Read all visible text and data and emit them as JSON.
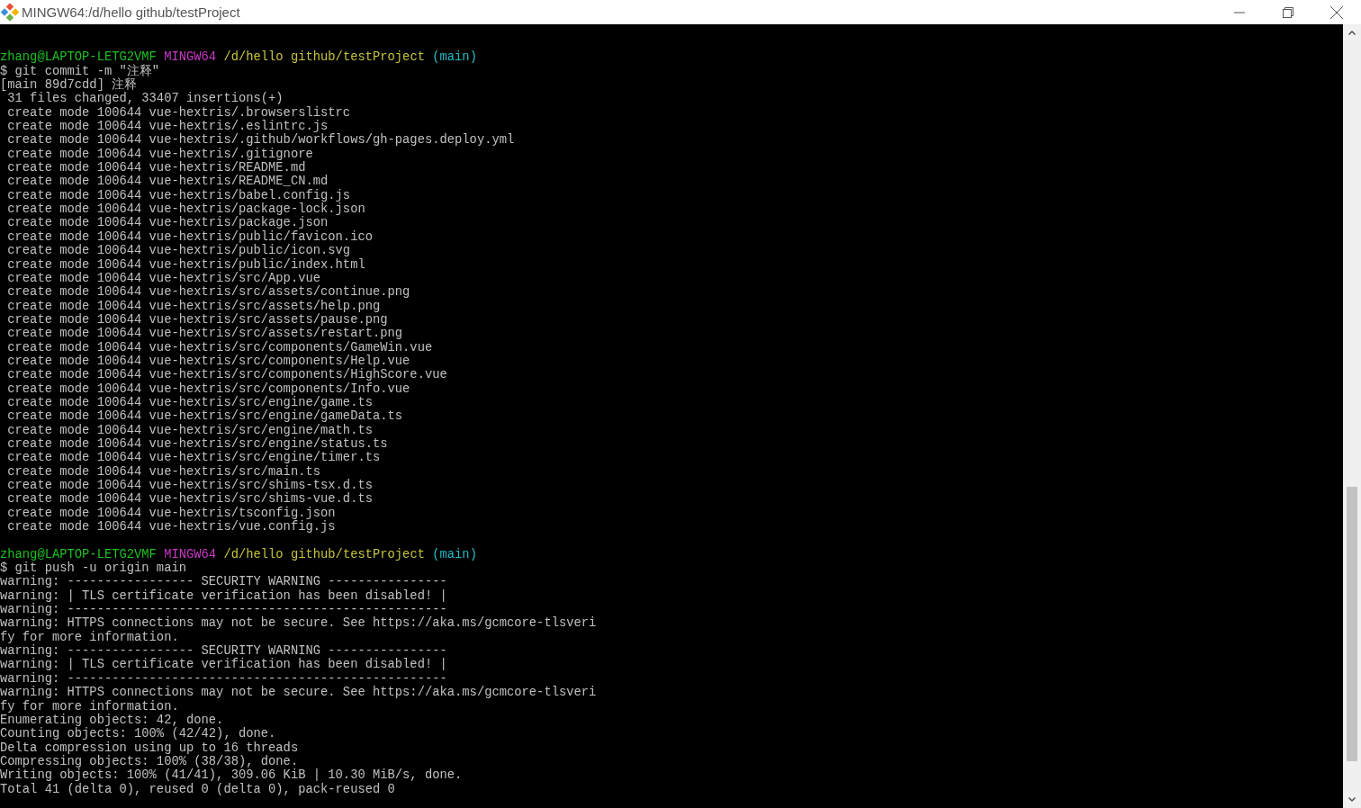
{
  "window": {
    "title": "MINGW64:/d/hello github/testProject"
  },
  "terminal": {
    "lines": [
      {
        "kind": "blank"
      },
      {
        "kind": "prompt",
        "user": "zhang@LAPTOP-LETG2VMF",
        "system": "MINGW64",
        "path": "/d/hello github/testProject",
        "branch": "(main)"
      },
      {
        "kind": "output",
        "text": "$ git commit -m \"注释\""
      },
      {
        "kind": "output",
        "text": "[main 89d7cdd] 注释"
      },
      {
        "kind": "output",
        "text": " 31 files changed, 33407 insertions(+)"
      },
      {
        "kind": "output",
        "text": " create mode 100644 vue-hextris/.browserslistrc"
      },
      {
        "kind": "output",
        "text": " create mode 100644 vue-hextris/.eslintrc.js"
      },
      {
        "kind": "output",
        "text": " create mode 100644 vue-hextris/.github/workflows/gh-pages.deploy.yml"
      },
      {
        "kind": "output",
        "text": " create mode 100644 vue-hextris/.gitignore"
      },
      {
        "kind": "output",
        "text": " create mode 100644 vue-hextris/README.md"
      },
      {
        "kind": "output",
        "text": " create mode 100644 vue-hextris/README_CN.md"
      },
      {
        "kind": "output",
        "text": " create mode 100644 vue-hextris/babel.config.js"
      },
      {
        "kind": "output",
        "text": " create mode 100644 vue-hextris/package-lock.json"
      },
      {
        "kind": "output",
        "text": " create mode 100644 vue-hextris/package.json"
      },
      {
        "kind": "output",
        "text": " create mode 100644 vue-hextris/public/favicon.ico"
      },
      {
        "kind": "output",
        "text": " create mode 100644 vue-hextris/public/icon.svg"
      },
      {
        "kind": "output",
        "text": " create mode 100644 vue-hextris/public/index.html"
      },
      {
        "kind": "output",
        "text": " create mode 100644 vue-hextris/src/App.vue"
      },
      {
        "kind": "output",
        "text": " create mode 100644 vue-hextris/src/assets/continue.png"
      },
      {
        "kind": "output",
        "text": " create mode 100644 vue-hextris/src/assets/help.png"
      },
      {
        "kind": "output",
        "text": " create mode 100644 vue-hextris/src/assets/pause.png"
      },
      {
        "kind": "output",
        "text": " create mode 100644 vue-hextris/src/assets/restart.png"
      },
      {
        "kind": "output",
        "text": " create mode 100644 vue-hextris/src/components/GameWin.vue"
      },
      {
        "kind": "output",
        "text": " create mode 100644 vue-hextris/src/components/Help.vue"
      },
      {
        "kind": "output",
        "text": " create mode 100644 vue-hextris/src/components/HighScore.vue"
      },
      {
        "kind": "output",
        "text": " create mode 100644 vue-hextris/src/components/Info.vue"
      },
      {
        "kind": "output",
        "text": " create mode 100644 vue-hextris/src/engine/game.ts"
      },
      {
        "kind": "output",
        "text": " create mode 100644 vue-hextris/src/engine/gameData.ts"
      },
      {
        "kind": "output",
        "text": " create mode 100644 vue-hextris/src/engine/math.ts"
      },
      {
        "kind": "output",
        "text": " create mode 100644 vue-hextris/src/engine/status.ts"
      },
      {
        "kind": "output",
        "text": " create mode 100644 vue-hextris/src/engine/timer.ts"
      },
      {
        "kind": "output",
        "text": " create mode 100644 vue-hextris/src/main.ts"
      },
      {
        "kind": "output",
        "text": " create mode 100644 vue-hextris/src/shims-tsx.d.ts"
      },
      {
        "kind": "output",
        "text": " create mode 100644 vue-hextris/src/shims-vue.d.ts"
      },
      {
        "kind": "output",
        "text": " create mode 100644 vue-hextris/tsconfig.json"
      },
      {
        "kind": "output",
        "text": " create mode 100644 vue-hextris/vue.config.js"
      },
      {
        "kind": "blank"
      },
      {
        "kind": "prompt",
        "user": "zhang@LAPTOP-LETG2VMF",
        "system": "MINGW64",
        "path": "/d/hello github/testProject",
        "branch": "(main)"
      },
      {
        "kind": "output",
        "text": "$ git push -u origin main"
      },
      {
        "kind": "output",
        "text": "warning: ----------------- SECURITY WARNING ----------------"
      },
      {
        "kind": "output",
        "text": "warning: | TLS certificate verification has been disabled! |"
      },
      {
        "kind": "output",
        "text": "warning: ---------------------------------------------------"
      },
      {
        "kind": "output",
        "text": "warning: HTTPS connections may not be secure. See https://aka.ms/gcmcore-tlsveri"
      },
      {
        "kind": "output",
        "text": "fy for more information."
      },
      {
        "kind": "output",
        "text": "warning: ----------------- SECURITY WARNING ----------------"
      },
      {
        "kind": "output",
        "text": "warning: | TLS certificate verification has been disabled! |"
      },
      {
        "kind": "output",
        "text": "warning: ---------------------------------------------------"
      },
      {
        "kind": "output",
        "text": "warning: HTTPS connections may not be secure. See https://aka.ms/gcmcore-tlsveri"
      },
      {
        "kind": "output",
        "text": "fy for more information."
      },
      {
        "kind": "output",
        "text": "Enumerating objects: 42, done."
      },
      {
        "kind": "output",
        "text": "Counting objects: 100% (42/42), done."
      },
      {
        "kind": "output",
        "text": "Delta compression using up to 16 threads"
      },
      {
        "kind": "output",
        "text": "Compressing objects: 100% (38/38), done."
      },
      {
        "kind": "output",
        "text": "Writing objects: 100% (41/41), 309.06 KiB | 10.30 MiB/s, done."
      },
      {
        "kind": "output",
        "text": "Total 41 (delta 0), reused 0 (delta 0), pack-reused 0"
      }
    ]
  }
}
